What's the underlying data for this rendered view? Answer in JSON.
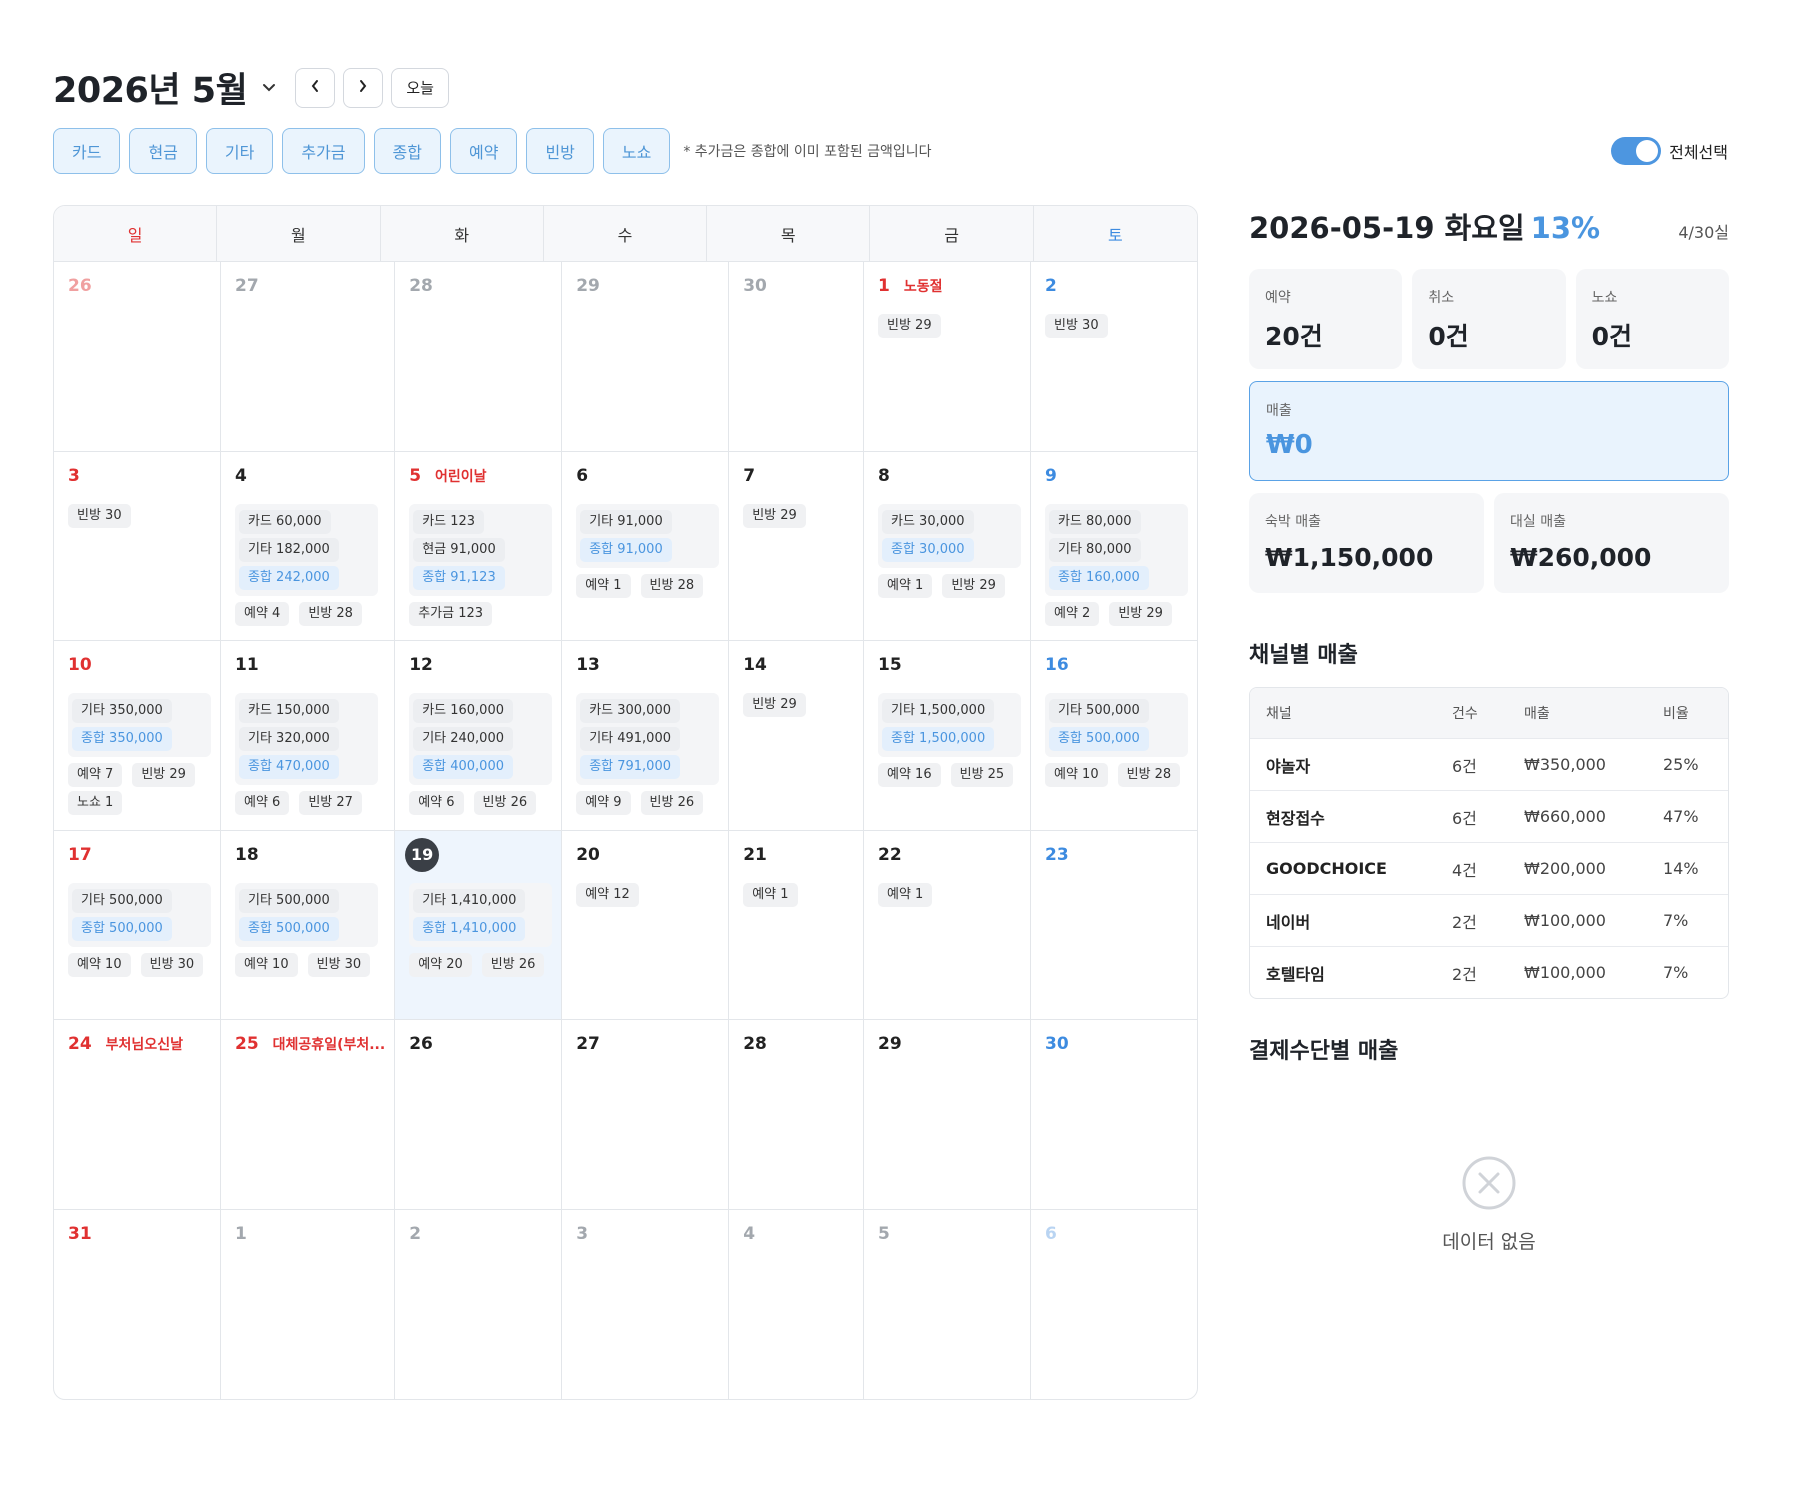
{
  "header": {
    "month": "2026년 5월",
    "today_label": "오늘"
  },
  "filters": {
    "chips": [
      "카드",
      "현금",
      "기타",
      "추가금",
      "종합",
      "예약",
      "빈방",
      "노쇼"
    ],
    "note": "* 추가금은 종합에 이미 포함된 금액입니다",
    "select_all": "전체선택"
  },
  "weekdays": [
    "일",
    "월",
    "화",
    "수",
    "목",
    "금",
    "토"
  ],
  "days": [
    {
      "num": "26",
      "tone": "mutedred"
    },
    {
      "num": "27",
      "tone": "muted"
    },
    {
      "num": "28",
      "tone": "muted"
    },
    {
      "num": "29",
      "tone": "muted"
    },
    {
      "num": "30",
      "tone": "muted"
    },
    {
      "num": "1",
      "tone": "red",
      "holiday": "노동절",
      "tags": [
        "빈방 29"
      ]
    },
    {
      "num": "2",
      "tone": "blue",
      "tags": [
        "빈방 30"
      ]
    },
    {
      "num": "3",
      "tone": "red",
      "tags": [
        "빈방 30"
      ]
    },
    {
      "num": "4",
      "tone": "normal",
      "block": [
        {
          "t": "카드 60,000"
        },
        {
          "t": "기타 182,000"
        },
        {
          "t": "종합 242,000",
          "total": true
        }
      ],
      "tags": [
        "예약 4",
        "빈방 28"
      ]
    },
    {
      "num": "5",
      "tone": "red",
      "holiday": "어린이날",
      "block": [
        {
          "t": "카드 123"
        },
        {
          "t": "현금 91,000"
        },
        {
          "t": "종합 91,123",
          "total": true
        }
      ],
      "tags": [
        "추가금 123"
      ]
    },
    {
      "num": "6",
      "tone": "normal",
      "block": [
        {
          "t": "기타 91,000"
        },
        {
          "t": "종합 91,000",
          "total": true
        }
      ],
      "tags": [
        "예약 1",
        "빈방 28"
      ]
    },
    {
      "num": "7",
      "tone": "normal",
      "tags": [
        "빈방 29"
      ]
    },
    {
      "num": "8",
      "tone": "normal",
      "block": [
        {
          "t": "카드 30,000"
        },
        {
          "t": "종합 30,000",
          "total": true
        }
      ],
      "tags": [
        "예약 1",
        "빈방 29"
      ]
    },
    {
      "num": "9",
      "tone": "blue",
      "block": [
        {
          "t": "카드 80,000"
        },
        {
          "t": "기타 80,000"
        },
        {
          "t": "종합 160,000",
          "total": true
        }
      ],
      "tags": [
        "예약 2",
        "빈방 29"
      ]
    },
    {
      "num": "10",
      "tone": "red",
      "block": [
        {
          "t": "기타 350,000"
        },
        {
          "t": "종합 350,000",
          "total": true
        }
      ],
      "tags": [
        "예약 7",
        "빈방 29",
        "노쇼 1"
      ]
    },
    {
      "num": "11",
      "tone": "normal",
      "block": [
        {
          "t": "카드 150,000"
        },
        {
          "t": "기타 320,000"
        },
        {
          "t": "종합 470,000",
          "total": true
        }
      ],
      "tags": [
        "예약 6",
        "빈방 27"
      ]
    },
    {
      "num": "12",
      "tone": "normal",
      "block": [
        {
          "t": "카드 160,000"
        },
        {
          "t": "기타 240,000"
        },
        {
          "t": "종합 400,000",
          "total": true
        }
      ],
      "tags": [
        "예약 6",
        "빈방 26"
      ]
    },
    {
      "num": "13",
      "tone": "normal",
      "block": [
        {
          "t": "카드 300,000"
        },
        {
          "t": "기타 491,000"
        },
        {
          "t": "종합 791,000",
          "total": true
        }
      ],
      "tags": [
        "예약 9",
        "빈방 26"
      ]
    },
    {
      "num": "14",
      "tone": "normal",
      "tags": [
        "빈방 29"
      ]
    },
    {
      "num": "15",
      "tone": "normal",
      "block": [
        {
          "t": "기타 1,500,000"
        },
        {
          "t": "종합 1,500,000",
          "total": true
        }
      ],
      "tags": [
        "예약 16",
        "빈방 25"
      ]
    },
    {
      "num": "16",
      "tone": "blue",
      "block": [
        {
          "t": "기타 500,000"
        },
        {
          "t": "종합 500,000",
          "total": true
        }
      ],
      "tags": [
        "예약 10",
        "빈방 28"
      ]
    },
    {
      "num": "17",
      "tone": "red",
      "block": [
        {
          "t": "기타 500,000"
        },
        {
          "t": "종합 500,000",
          "total": true
        }
      ],
      "tags": [
        "예약 10",
        "빈방 30"
      ]
    },
    {
      "num": "18",
      "tone": "normal",
      "block": [
        {
          "t": "기타 500,000"
        },
        {
          "t": "종합 500,000",
          "total": true
        }
      ],
      "tags": [
        "예약 10",
        "빈방 30"
      ]
    },
    {
      "num": "19",
      "tone": "circle",
      "selected": true,
      "block": [
        {
          "t": "기타 1,410,000"
        },
        {
          "t": "종합 1,410,000",
          "total": true
        }
      ],
      "tags": [
        "예약 20",
        "빈방 26"
      ]
    },
    {
      "num": "20",
      "tone": "normal",
      "tags": [
        "예약 12"
      ]
    },
    {
      "num": "21",
      "tone": "normal",
      "tags": [
        "예약 1"
      ]
    },
    {
      "num": "22",
      "tone": "normal",
      "tags": [
        "예약 1"
      ]
    },
    {
      "num": "23",
      "tone": "blue"
    },
    {
      "num": "24",
      "tone": "red",
      "holiday": "부처님오신날"
    },
    {
      "num": "25",
      "tone": "red",
      "holiday": "대체공휴일(부처..."
    },
    {
      "num": "26",
      "tone": "normal"
    },
    {
      "num": "27",
      "tone": "normal"
    },
    {
      "num": "28",
      "tone": "normal"
    },
    {
      "num": "29",
      "tone": "normal"
    },
    {
      "num": "30",
      "tone": "blue"
    },
    {
      "num": "31",
      "tone": "red"
    },
    {
      "num": "1",
      "tone": "muted"
    },
    {
      "num": "2",
      "tone": "muted"
    },
    {
      "num": "3",
      "tone": "muted"
    },
    {
      "num": "4",
      "tone": "muted"
    },
    {
      "num": "5",
      "tone": "muted"
    },
    {
      "num": "6",
      "tone": "mutedblue"
    }
  ],
  "panel": {
    "date": "2026-05-19 화요일",
    "pct": "13%",
    "rooms": "4/30실",
    "stats": [
      {
        "label": "예약",
        "value": "20건"
      },
      {
        "label": "취소",
        "value": "0건"
      },
      {
        "label": "노쇼",
        "value": "0건"
      }
    ],
    "revenue": {
      "label": "매출",
      "value": "₩0"
    },
    "stats2": [
      {
        "label": "숙박 매출",
        "value": "₩1,150,000"
      },
      {
        "label": "대실 매출",
        "value": "₩260,000"
      }
    ],
    "channel_title": "채널별 매출",
    "channel_headers": [
      "채널",
      "건수",
      "매출",
      "비율"
    ],
    "channels": [
      {
        "name": "야놀자",
        "count": "6건",
        "sales": "₩350,000",
        "ratio": "25%"
      },
      {
        "name": "현장접수",
        "count": "6건",
        "sales": "₩660,000",
        "ratio": "47%"
      },
      {
        "name": "GOODCHOICE",
        "count": "4건",
        "sales": "₩200,000",
        "ratio": "14%"
      },
      {
        "name": "네이버",
        "count": "2건",
        "sales": "₩100,000",
        "ratio": "7%"
      },
      {
        "name": "호텔타임",
        "count": "2건",
        "sales": "₩100,000",
        "ratio": "7%"
      }
    ],
    "payment_title": "결제수단별 매출",
    "empty_text": "데이터 없음"
  },
  "colors": {
    "accent": "#4a95df",
    "sunday": "#e03131",
    "saturday": "#3d8be0",
    "selected_bg": "#eef5fd"
  },
  "icons": {
    "month_dropdown": "chevron-down-icon",
    "prev": "chevron-left-icon",
    "next": "chevron-right-icon",
    "empty": "close-circle-icon"
  }
}
